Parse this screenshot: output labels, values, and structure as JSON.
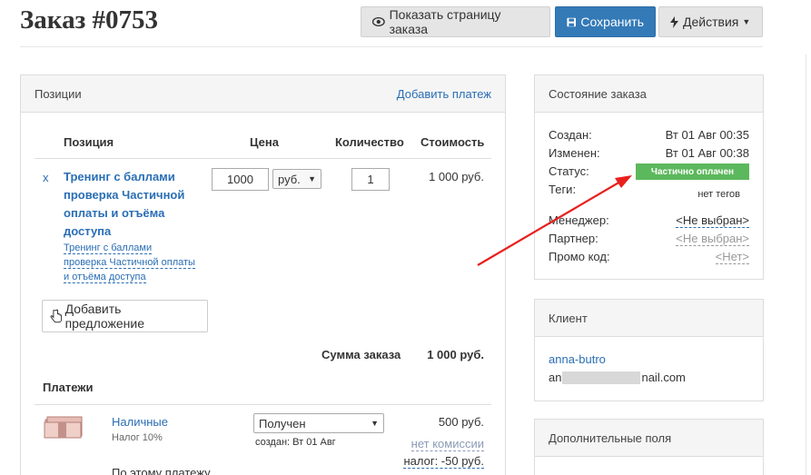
{
  "header": {
    "title": "Заказ #0753",
    "show_page_label": "Показать страницу заказа",
    "save_label": "Сохранить",
    "actions_label": "Действия"
  },
  "positions": {
    "title": "Позиции",
    "add_payment": "Добавить платеж",
    "columns": [
      "Позиция",
      "Цена",
      "Количество",
      "Стоимость"
    ],
    "item": {
      "remove": "x",
      "name": "Тренинг с баллами проверка Частичной оплаты и отъёма доступа",
      "subname": "Тренинг с баллами проверка Частичной оплаты и отъёма доступа",
      "price": "1000",
      "currency": "руб.",
      "quantity": "1",
      "cost": "1 000 руб."
    },
    "add_offer": "Добавить предложение",
    "sum_label": "Сумма заказа",
    "sum_value": "1 000 руб."
  },
  "payments": {
    "title": "Платежи",
    "item": {
      "method": "Наличные",
      "tax": "Налог 10%",
      "status": "Получен",
      "created": "создан: Вт 01 Авг",
      "amount": "500 руб.",
      "commission": "нет комиссии",
      "tax_amount": "налог: -50 руб.",
      "note": "По этому платежу"
    }
  },
  "order_state": {
    "title": "Состояние заказа",
    "created_label": "Создан:",
    "created_value": "Вт 01 Авг 00:35",
    "changed_label": "Изменен:",
    "changed_value": "Вт 01 Авг 00:38",
    "status_label": "Статус:",
    "status_value": "Частично оплачен",
    "tags_label": "Теги:",
    "tags_value": "нет тегов",
    "manager_label": "Менеджер:",
    "manager_value": "<Не выбран>",
    "partner_label": "Партнер:",
    "partner_value": "<Не выбран>",
    "promo_label": "Промо код:",
    "promo_value": "<Нет>"
  },
  "client": {
    "title": "Клиент",
    "name": "anna-butro",
    "email_prefix": "an",
    "email_suffix": "nail.com"
  },
  "extra_fields": {
    "title": "Дополнительные поля"
  },
  "colors": {
    "primary": "#337ab7",
    "link": "#2a6eb5",
    "badge": "#5cb85c",
    "arrow": "#e8201e"
  }
}
